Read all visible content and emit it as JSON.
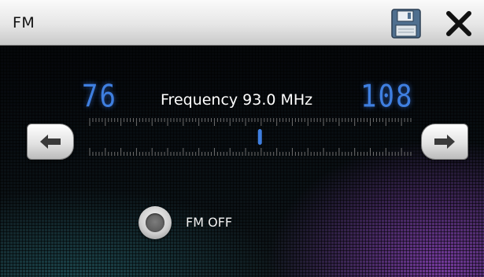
{
  "window": {
    "title": "FM"
  },
  "toolbar": {
    "save_icon": "floppy-disk-icon",
    "close_icon": "close-x-icon"
  },
  "tuner": {
    "min_frequency": "76",
    "max_frequency": "108",
    "frequency_label": "Frequency",
    "frequency_value": "93.0 MHz",
    "tuning_position": 0.53
  },
  "buttons": {
    "tune_down_icon": "arrow-left-icon",
    "tune_up_icon": "arrow-right-icon"
  },
  "fm_toggle": {
    "label": "FM OFF"
  },
  "colors": {
    "digit_blue": "#3f7fe0",
    "glow_purple": "#9646c8"
  }
}
